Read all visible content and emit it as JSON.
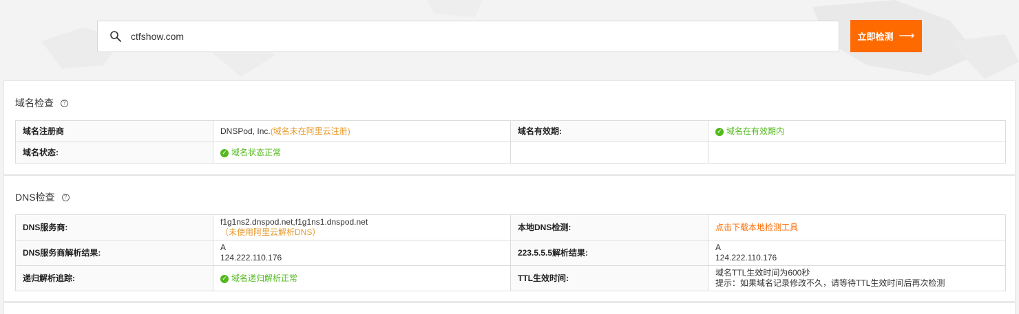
{
  "search": {
    "value": "ctfshow.com",
    "button_label": "立即检测",
    "button_arrow": "⟶"
  },
  "domain_check": {
    "title": "域名检查",
    "help": "?",
    "registrar_label": "域名注册商",
    "registrar_value": "DNSPod, Inc.",
    "registrar_note": "(域名未在阿里云注册)",
    "expiry_label": "域名有效期:",
    "expiry_value": "域名在有效期内",
    "status_label": "域名状态:",
    "status_value": "域名状态正常"
  },
  "dns_check": {
    "title": "DNS检查",
    "help": "?",
    "provider_label": "DNS服务商:",
    "provider_value": "f1g1ns2.dnspod.net,f1g1ns1.dnspod.net",
    "provider_note": "（未使用阿里云解析DNS）",
    "local_label": "本地DNS检测:",
    "local_link": "点击下载本地检测工具",
    "resolve_label": "DNS服务商解析结果:",
    "resolve_type": "A",
    "resolve_ip": "124.222.110.176",
    "ali_label": "223.5.5.5解析结果:",
    "ali_type": "A",
    "ali_ip": "124.222.110.176",
    "trace_label": "递归解析追踪:",
    "trace_value": "域名递归解析正常",
    "ttl_label": "TTL生效时间:",
    "ttl_value": "域名TTL生效时间为600秒",
    "ttl_tip": "提示：如果域名记录修改不久，请等待TTL生效时间后再次检测"
  },
  "colors": {
    "accent": "#ff6a00",
    "ok": "#52b91c",
    "warn": "#e89b2e"
  },
  "icons": {
    "search": "search-icon",
    "ok": "check-circle-icon",
    "help": "question-circle-icon"
  }
}
